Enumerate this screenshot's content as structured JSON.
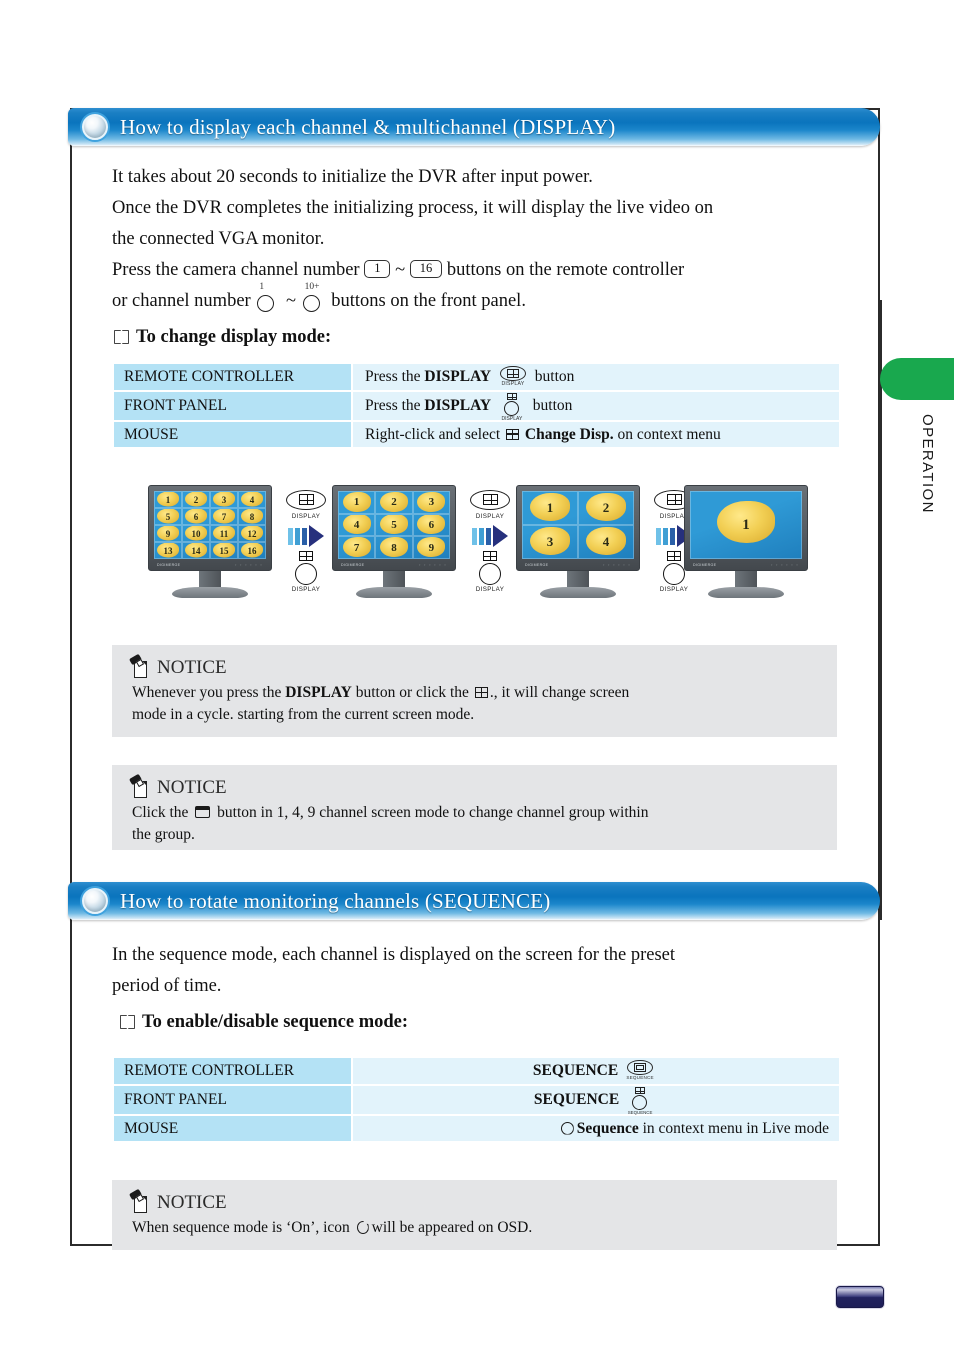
{
  "section1": {
    "title": "How to display each channel & multichannel (DISPLAY)",
    "paragraph": {
      "line1": "It takes about 20 seconds to initialize the DVR after input power.",
      "line2": "Once the DVR completes the initializing process, it will display the live video on",
      "line3": "the connected VGA monitor.",
      "line4_a": "Press the camera channel number",
      "line4_key_from": "1",
      "line4_tilde": "~",
      "line4_key_to": "16",
      "line4_b": "buttons on the remote controller",
      "line5_a": "or channel number",
      "line5_key_from": "1",
      "line5_tilde": "~",
      "line5_key_to": "10+",
      "line5_b": "buttons on the front panel."
    },
    "subheading": "To change display mode:",
    "table": {
      "rows": [
        {
          "device": "REMOTE CONTROLLER",
          "action_pre": "Press the",
          "action_bold": "DISPLAY",
          "icon": "display-oval-button-icon",
          "icon_caption": "DISPLAY",
          "action_post": "button"
        },
        {
          "device": "FRONT PANEL",
          "action_pre": "Press the",
          "action_bold": "DISPLAY",
          "icon": "display-round-button-icon",
          "icon_caption": "DISPLAY",
          "action_post": "button"
        },
        {
          "device": "MOUSE",
          "action_pre": "Right-click and select",
          "icon": "four-pane-grid-icon",
          "action_bold": "Change Disp.",
          "action_post": "on context menu"
        }
      ]
    },
    "diagram": {
      "monitors": [
        {
          "name": "16-split-monitor",
          "split": 16,
          "cols": 4,
          "rows": 4,
          "channels": [
            "1",
            "2",
            "3",
            "4",
            "5",
            "6",
            "7",
            "8",
            "9",
            "10",
            "11",
            "12",
            "13",
            "14",
            "15",
            "16"
          ]
        },
        {
          "name": "9-split-monitor",
          "split": 9,
          "cols": 3,
          "rows": 3,
          "channels": [
            "1",
            "2",
            "3",
            "4",
            "5",
            "6",
            "7",
            "8",
            "9"
          ]
        },
        {
          "name": "4-split-monitor",
          "split": 4,
          "cols": 2,
          "rows": 2,
          "channels": [
            "1",
            "2",
            "3",
            "4"
          ]
        },
        {
          "name": "single-monitor",
          "split": 1,
          "cols": 1,
          "rows": 1,
          "channels": [
            "1"
          ]
        }
      ],
      "button_label": "DISPLAY",
      "monitor_brand": "DIGIMERGE",
      "monitor_controls": "◦ ◦ ◦ ◦ ◦ ◦"
    },
    "notices": [
      {
        "heading": "NOTICE",
        "line1_a": "Whenever you press the",
        "line1_bold": "DISPLAY",
        "line1_b": "button or click the",
        "line1_icon": "four-pane-grid-icon",
        "line1_c": "., it will change screen",
        "line2": "mode in a cycle. starting from the current screen mode."
      },
      {
        "heading": "NOTICE",
        "line1_a": "Click the",
        "line1_icon": "window-button-icon",
        "line1_b": "button in 1, 4, 9 channel screen mode to change channel group within",
        "line2": "the group."
      }
    ]
  },
  "section2": {
    "title": "How to rotate monitoring channels (SEQUENCE)",
    "paragraph": {
      "line1": "In the sequence mode, each channel is displayed on the screen for the preset",
      "line2": "period of time."
    },
    "subheading": "To enable/disable sequence mode:",
    "table": {
      "rows": [
        {
          "device": "REMOTE CONTROLLER",
          "action_bold": "SEQUENCE",
          "icon": "sequence-oval-button-icon",
          "icon_caption": "SEQUENCE"
        },
        {
          "device": "FRONT PANEL",
          "action_bold": "SEQUENCE",
          "icon": "sequence-round-button-icon",
          "icon_caption": "SEQUENCE"
        },
        {
          "device": "MOUSE",
          "icon": "sequence-circle-icon",
          "action_bold": "Sequence",
          "action_post": "in context menu in Live mode"
        }
      ]
    },
    "notice": {
      "heading": "NOTICE",
      "line1_a": "When sequence mode is ‘On’, icon",
      "line1_icon": "sequence-circle-icon",
      "line1_b": "will be appeared on OSD."
    }
  },
  "sidebar": {
    "tab_label": "OPERATION",
    "tab_color": "#19a84e"
  },
  "page_chip": {
    "label": "",
    "color": "#1e1f58"
  },
  "colors": {
    "header_blue": "#0a74bd",
    "table_left": "#b4e2f5",
    "table_right": "#e2f3fb",
    "notice_bg": "#e4e5e7",
    "arrow_navy": "#26307d"
  }
}
